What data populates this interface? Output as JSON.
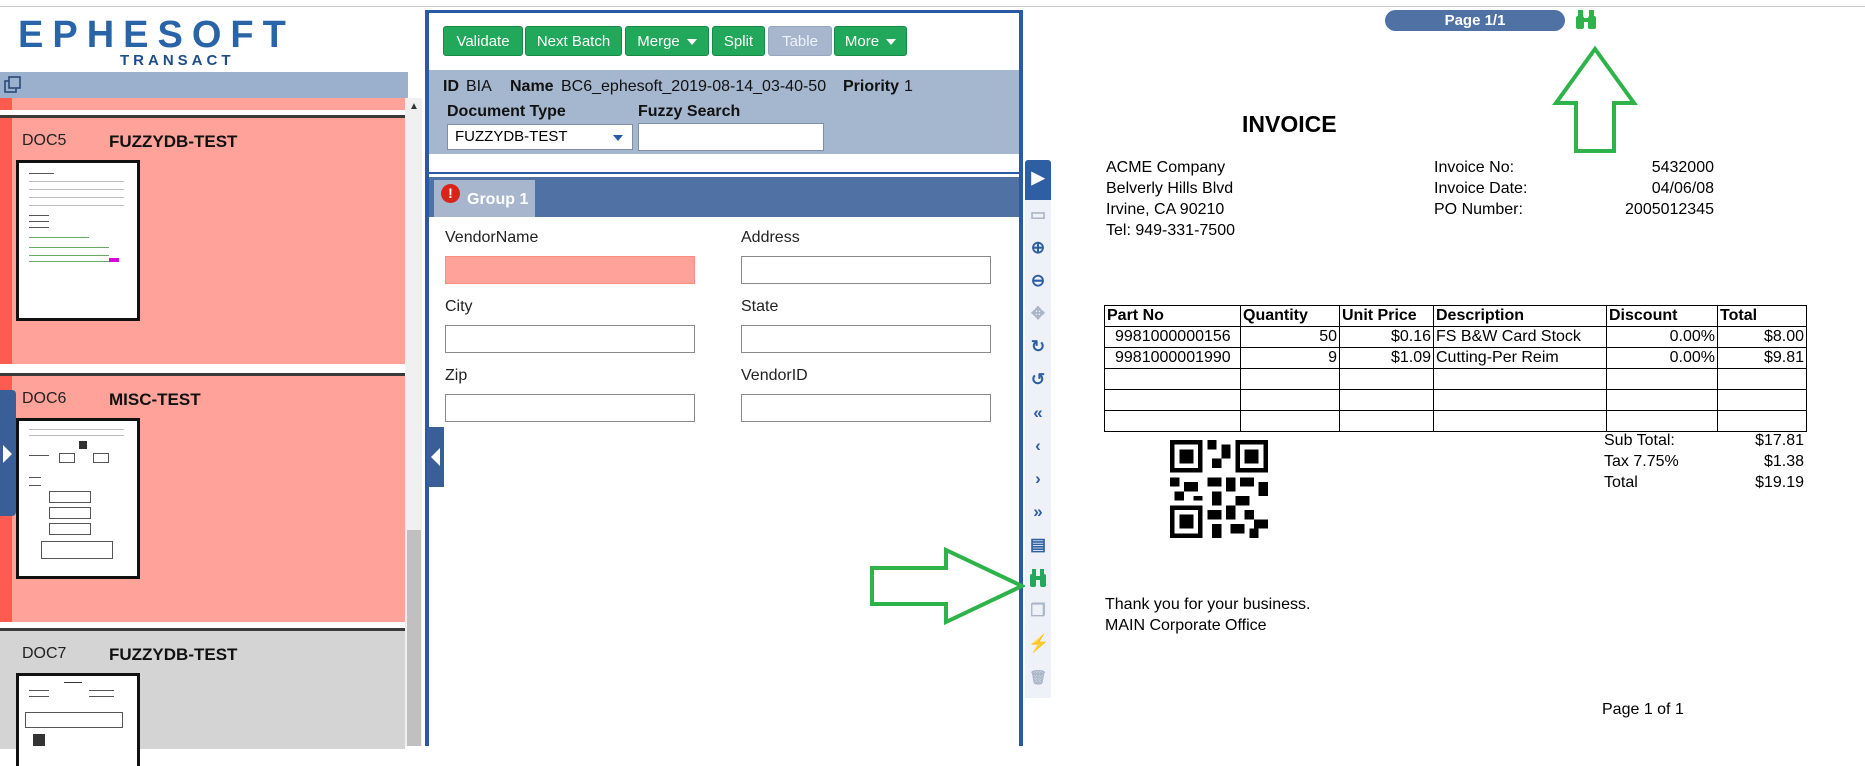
{
  "app": {
    "logo_main": "EPHESOFT",
    "logo_sub": "TRANSACT"
  },
  "documents": [
    {
      "id": "DOC5",
      "type": "FUZZYDB-TEST",
      "state": "error"
    },
    {
      "id": "DOC6",
      "type": "MISC-TEST",
      "state": "error"
    },
    {
      "id": "DOC7",
      "type": "FUZZYDB-TEST",
      "state": "normal"
    }
  ],
  "toolbar": {
    "validate": "Validate",
    "next_batch": "Next Batch",
    "merge": "Merge",
    "split": "Split",
    "table": "Table",
    "more": "More"
  },
  "batch_info": {
    "id_label": "ID",
    "id_value": "BIA",
    "name_label": "Name",
    "name_value": "BC6_ephesoft_2019-08-14_03-40-50",
    "priority_label": "Priority",
    "priority_value": "1",
    "doc_type_label": "Document Type",
    "doc_type_value": "FUZZYDB-TEST",
    "fuzzy_label": "Fuzzy Search",
    "fuzzy_value": ""
  },
  "group": {
    "label": "Group 1",
    "error_glyph": "!"
  },
  "fields": [
    {
      "label": "VendorName",
      "value": "",
      "error": true
    },
    {
      "label": "Address",
      "value": "",
      "error": false
    },
    {
      "label": "City",
      "value": "",
      "error": false
    },
    {
      "label": "State",
      "value": "",
      "error": false
    },
    {
      "label": "Zip",
      "value": "",
      "error": false
    },
    {
      "label": "VendorID",
      "value": "",
      "error": false
    }
  ],
  "tools": [
    {
      "name": "play-icon",
      "glyph": "▶"
    },
    {
      "name": "split-view-icon",
      "glyph": "▭"
    },
    {
      "name": "zoom-in-icon",
      "glyph": "⊕"
    },
    {
      "name": "zoom-out-icon",
      "glyph": "⊖"
    },
    {
      "name": "move-icon",
      "glyph": "✥"
    },
    {
      "name": "rotate-right-icon",
      "glyph": "↻"
    },
    {
      "name": "rotate-left-icon",
      "glyph": "↺"
    },
    {
      "name": "first-page-icon",
      "glyph": "«"
    },
    {
      "name": "prev-page-icon",
      "glyph": "‹"
    },
    {
      "name": "next-page-icon",
      "glyph": "›"
    },
    {
      "name": "last-page-icon",
      "glyph": "»"
    },
    {
      "name": "document-icon",
      "glyph": "▤"
    },
    {
      "name": "binoculars-icon",
      "glyph": "⌕"
    },
    {
      "name": "copy-icon",
      "glyph": "❐"
    },
    {
      "name": "plug-icon",
      "glyph": "⚡"
    },
    {
      "name": "trash-icon",
      "glyph": "🗑"
    }
  ],
  "viewer": {
    "page_indicator": "Page 1/1",
    "invoice_title": "INVOICE",
    "company": [
      "ACME Company",
      "Belverly Hills Blvd",
      "Irvine, CA 90210",
      "Tel: 949-331-7500"
    ],
    "meta": [
      {
        "label": "Invoice No:",
        "value": "5432000"
      },
      {
        "label": "Invoice Date:",
        "value": "04/06/08"
      },
      {
        "label": "PO Number:",
        "value": "2005012345"
      }
    ],
    "table_headers": [
      "Part No",
      "Quantity",
      "Unit Price",
      "Description",
      "Discount",
      "Total"
    ],
    "table_rows": [
      [
        "9981000000156",
        "50",
        "$0.16",
        "FS B&W Card Stock",
        "0.00%",
        "$8.00"
      ],
      [
        "9981000001990",
        "9",
        "$1.09",
        "Cutting-Per Reim",
        "0.00%",
        "$9.81"
      ]
    ],
    "totals": [
      {
        "label": "Sub Total:",
        "value": "$17.81"
      },
      {
        "label": "Tax 7.75%",
        "value": "$1.38"
      },
      {
        "label": "Total",
        "value": "$19.19"
      }
    ],
    "footer_lines": [
      "Thank you for your business.",
      "MAIN Corporate Office"
    ],
    "page_footer": "Page 1 of 1"
  },
  "colors": {
    "accent_green": "#22a85a",
    "brand_blue": "#2a5aa6",
    "error_red": "#ffa39a",
    "annotation_arrow": "#2db34a"
  }
}
